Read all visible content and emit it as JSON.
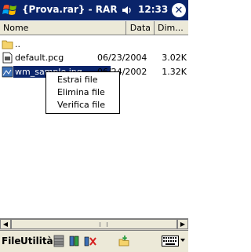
{
  "titlebar": {
    "title": "{Prova.rar} - RAR",
    "clock": "12:33",
    "close_glyph": "✕"
  },
  "columns": {
    "name": "Nome",
    "date": "Data",
    "size": "Dim..."
  },
  "files": [
    {
      "name": "..",
      "date": "",
      "size": "",
      "icon": "folder-icon"
    },
    {
      "name": "default.pcg",
      "date": "06/23/2004",
      "size": "3.02K",
      "icon": "file-icon"
    },
    {
      "name": "wm_sample.jpg",
      "date": "06/24/2002",
      "size": "1.32K",
      "icon": "image-file-icon"
    }
  ],
  "context_menu": {
    "items": [
      "Estrai file",
      "Elimina file",
      "Verifica file"
    ]
  },
  "menubar": {
    "file": "File",
    "utility": "Utilità"
  },
  "colors": {
    "titlebar": "#0a246a",
    "selection": "#0a246a",
    "chrome": "#ece9d8"
  }
}
